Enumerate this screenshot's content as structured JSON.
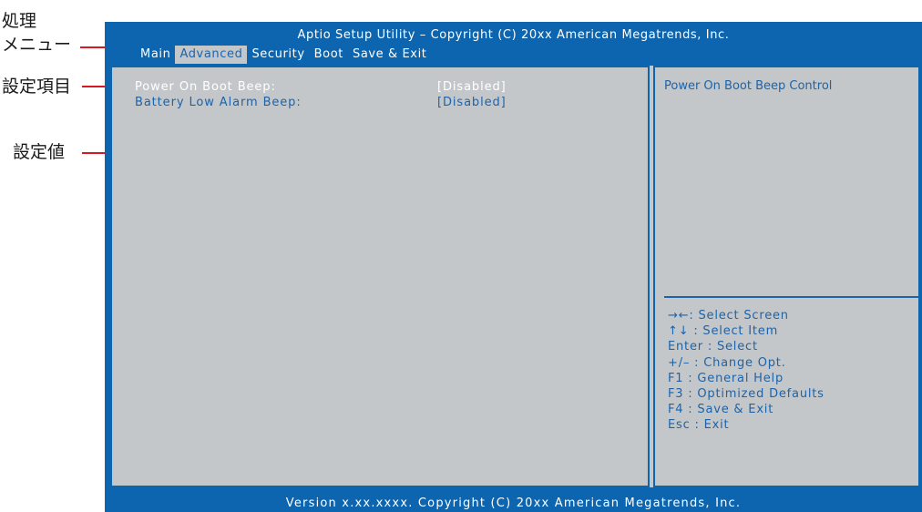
{
  "annotations": {
    "menu_label_line1": "処理",
    "menu_label_line2": "メニュー",
    "items_label": "設定項目",
    "value_label": "設定値"
  },
  "bios": {
    "title": "Aptio Setup Utility – Copyright (C) 20xx American Megatrends, Inc.",
    "menu": [
      "Main",
      "Advanced",
      "Security",
      "Boot",
      "Save & Exit"
    ],
    "active_menu": "Advanced",
    "settings": [
      {
        "label": "Power On Boot Beep:",
        "value": "[Disabled]",
        "selected": true
      },
      {
        "label": "Battery Low Alarm Beep:",
        "value": "[Disabled]",
        "selected": false
      }
    ],
    "help_text": "Power On Boot Beep Control",
    "keys": [
      "→←: Select Screen",
      "↑↓ : Select Item",
      "Enter : Select",
      "+/– : Change Opt.",
      "F1 : General Help",
      "F3 : Optimized Defaults",
      "F4 : Save & Exit",
      "Esc : Exit"
    ],
    "footer": "Version x.xx.xxxx. Copyright (C) 20xx American Megatrends, Inc."
  },
  "colors": {
    "bios_blue": "#0c65ae",
    "panel_gray": "#c4c7c9",
    "text_blue": "#1d63a9",
    "annotation_red": "#d51a23"
  }
}
